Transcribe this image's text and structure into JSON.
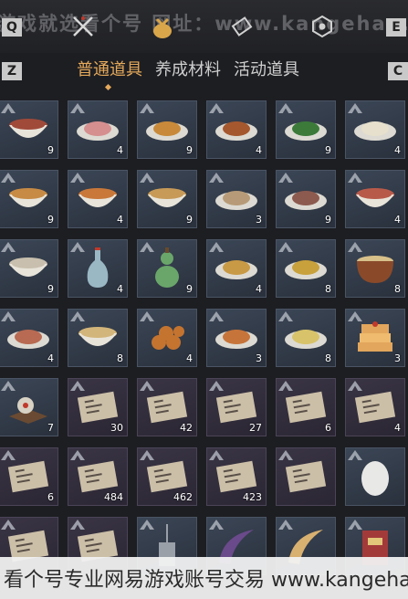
{
  "keys": {
    "q": "Q",
    "e": "E",
    "z": "Z",
    "c": "C"
  },
  "watermark_top": "游戏就选看个号 网址：www.kangehao.com",
  "watermark_bottom": "看个号专业网易游戏账号交易 www.kangehao.com",
  "tabs": [
    {
      "label": "普通道具",
      "active": true
    },
    {
      "label": "养成材料",
      "active": false
    },
    {
      "label": "活动道具",
      "active": false
    }
  ],
  "items": [
    {
      "count": "9",
      "kind": "bowl",
      "color": "#a04a3a"
    },
    {
      "count": "4",
      "kind": "plate",
      "color": "#d58f8f"
    },
    {
      "count": "9",
      "kind": "plate",
      "color": "#c88a3a"
    },
    {
      "count": "4",
      "kind": "plate",
      "color": "#a5582e"
    },
    {
      "count": "9",
      "kind": "plate",
      "color": "#3c7a3a"
    },
    {
      "count": "4",
      "kind": "plate",
      "color": "#e6e0cc"
    },
    {
      "count": "9",
      "kind": "bowl",
      "color": "#c78b45"
    },
    {
      "count": "4",
      "kind": "bowl",
      "color": "#c9783a"
    },
    {
      "count": "9",
      "kind": "bowl",
      "color": "#c79a58"
    },
    {
      "count": "3",
      "kind": "plate",
      "color": "#b79b78"
    },
    {
      "count": "9",
      "kind": "plate",
      "color": "#8d5a4f"
    },
    {
      "count": "4",
      "kind": "bowl",
      "color": "#b85a4a"
    },
    {
      "count": "9",
      "kind": "bowl",
      "color": "#c8bfae"
    },
    {
      "count": "4",
      "kind": "vase",
      "color": "#9ab7c4"
    },
    {
      "count": "9",
      "kind": "gourd",
      "color": "#6aa66a"
    },
    {
      "count": "4",
      "kind": "plate",
      "color": "#c99a45"
    },
    {
      "count": "8",
      "kind": "plate",
      "color": "#c8a13c"
    },
    {
      "count": "8",
      "kind": "pot",
      "color": "#8a4a2a"
    },
    {
      "count": "4",
      "kind": "plate",
      "color": "#b86a52"
    },
    {
      "count": "8",
      "kind": "bowl",
      "color": "#d2b57a"
    },
    {
      "count": "4",
      "kind": "balls",
      "color": "#c4742f"
    },
    {
      "count": "3",
      "kind": "plate",
      "color": "#c7743a"
    },
    {
      "count": "8",
      "kind": "plate",
      "color": "#d8c36a"
    },
    {
      "count": "3",
      "kind": "cake",
      "color": "#e2a65c"
    },
    {
      "count": "7",
      "kind": "dessert",
      "color": "#d8d2c4"
    },
    {
      "count": "30",
      "kind": "scroll",
      "color": "#cbbfa8"
    },
    {
      "count": "42",
      "kind": "scroll",
      "color": "#cbbfa8"
    },
    {
      "count": "27",
      "kind": "scroll",
      "color": "#cbbfa8"
    },
    {
      "count": "6",
      "kind": "scroll",
      "color": "#cbbfa8"
    },
    {
      "count": "4",
      "kind": "scroll",
      "color": "#cbbfa8"
    },
    {
      "count": "6",
      "kind": "scroll",
      "color": "#cbbfa8"
    },
    {
      "count": "484",
      "kind": "scroll",
      "color": "#cbbfa8"
    },
    {
      "count": "462",
      "kind": "scroll",
      "color": "#cbbfa8"
    },
    {
      "count": "423",
      "kind": "scroll",
      "color": "#cbbfa8"
    },
    {
      "count": "",
      "kind": "scroll",
      "color": "#cbbfa8"
    },
    {
      "count": "",
      "kind": "egg",
      "color": "#e8e8e6"
    },
    {
      "count": "",
      "kind": "scroll",
      "color": "#cbbfa8"
    },
    {
      "count": "",
      "kind": "scroll",
      "color": "#cbbfa8"
    },
    {
      "count": "",
      "kind": "lantern",
      "color": "#9aa0a8"
    },
    {
      "count": "",
      "kind": "horn",
      "color": "#6a4a8a"
    },
    {
      "count": "",
      "kind": "horn",
      "color": "#d8b070"
    },
    {
      "count": "",
      "kind": "book",
      "color": "#a33a3a"
    }
  ]
}
